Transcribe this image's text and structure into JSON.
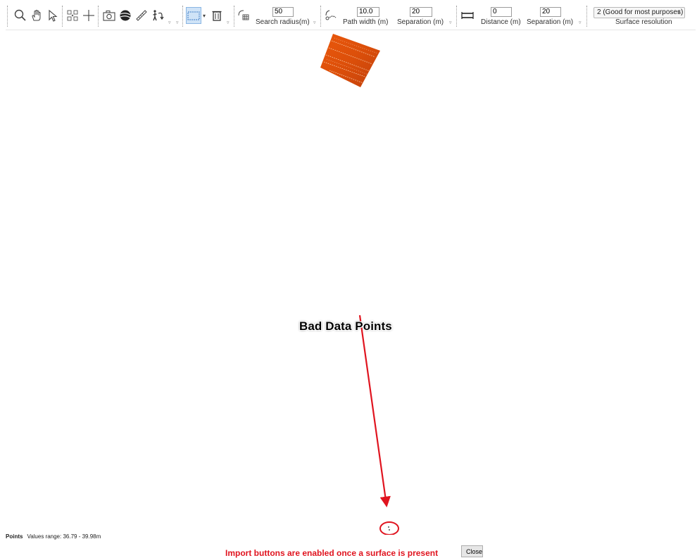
{
  "toolbar": {
    "tools": [
      {
        "icon": "zoom-icon"
      },
      {
        "icon": "pan-hand-icon"
      },
      {
        "icon": "select-pointer-icon"
      },
      {
        "icon": "zoom-extents-icon"
      },
      {
        "icon": "crosshair-icon"
      },
      {
        "icon": "camera-icon"
      },
      {
        "icon": "globe-icon"
      },
      {
        "icon": "measure-ruler-icon"
      },
      {
        "icon": "walk-icon"
      },
      {
        "icon": "rectangle-select-icon"
      },
      {
        "icon": "delete-trash-icon"
      },
      {
        "icon": "search-grid-icon"
      },
      {
        "icon": "path-icon"
      },
      {
        "icon": "distance-icon"
      }
    ],
    "search_radius": {
      "value": "50",
      "label": "Search radius(m)"
    },
    "path_width": {
      "value": "10.0",
      "label": "Path width (m)"
    },
    "path_separation": {
      "value": "20",
      "label": "Separation (m)"
    },
    "distance": {
      "value": "0",
      "label": "Distance (m)"
    },
    "distance_separation": {
      "value": "20",
      "label": "Separation (m)"
    },
    "surface_resolution": {
      "value": "2 (Good for most purposes)",
      "label": "Surface resolution"
    }
  },
  "canvas": {
    "annotation": "Bad Data Points",
    "annotation_color": "#e0141f",
    "surface_colors": [
      "#c2410c",
      "#ea580c",
      "#f97316"
    ]
  },
  "status": {
    "title": "Points",
    "range": "Values range: 36.79 - 39.98m"
  },
  "footer": {
    "import_message": "Import buttons are enabled once a surface is present",
    "close_label": "Close"
  }
}
